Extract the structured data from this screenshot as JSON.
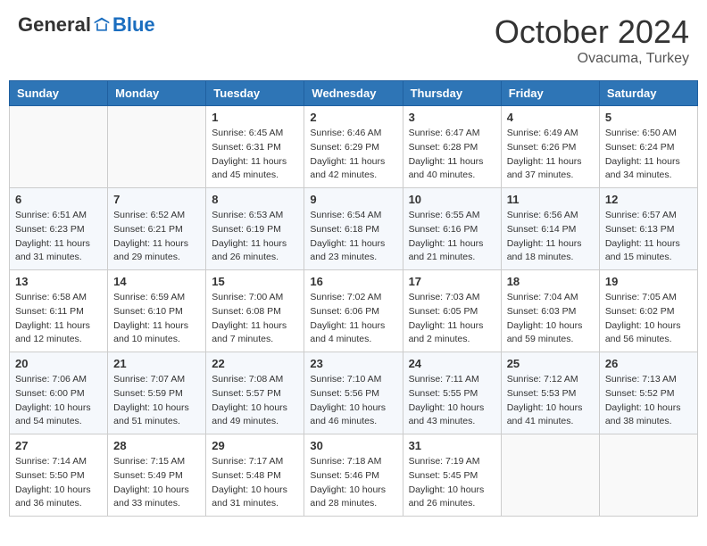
{
  "header": {
    "logo": {
      "general": "General",
      "blue": "Blue",
      "tagline": ""
    },
    "title": "October 2024",
    "subtitle": "Ovacuma, Turkey"
  },
  "weekdays": [
    "Sunday",
    "Monday",
    "Tuesday",
    "Wednesday",
    "Thursday",
    "Friday",
    "Saturday"
  ],
  "weeks": [
    [
      {
        "day": "",
        "sunrise": "",
        "sunset": "",
        "daylight": ""
      },
      {
        "day": "",
        "sunrise": "",
        "sunset": "",
        "daylight": ""
      },
      {
        "day": "1",
        "sunrise": "Sunrise: 6:45 AM",
        "sunset": "Sunset: 6:31 PM",
        "daylight": "Daylight: 11 hours and 45 minutes."
      },
      {
        "day": "2",
        "sunrise": "Sunrise: 6:46 AM",
        "sunset": "Sunset: 6:29 PM",
        "daylight": "Daylight: 11 hours and 42 minutes."
      },
      {
        "day": "3",
        "sunrise": "Sunrise: 6:47 AM",
        "sunset": "Sunset: 6:28 PM",
        "daylight": "Daylight: 11 hours and 40 minutes."
      },
      {
        "day": "4",
        "sunrise": "Sunrise: 6:49 AM",
        "sunset": "Sunset: 6:26 PM",
        "daylight": "Daylight: 11 hours and 37 minutes."
      },
      {
        "day": "5",
        "sunrise": "Sunrise: 6:50 AM",
        "sunset": "Sunset: 6:24 PM",
        "daylight": "Daylight: 11 hours and 34 minutes."
      }
    ],
    [
      {
        "day": "6",
        "sunrise": "Sunrise: 6:51 AM",
        "sunset": "Sunset: 6:23 PM",
        "daylight": "Daylight: 11 hours and 31 minutes."
      },
      {
        "day": "7",
        "sunrise": "Sunrise: 6:52 AM",
        "sunset": "Sunset: 6:21 PM",
        "daylight": "Daylight: 11 hours and 29 minutes."
      },
      {
        "day": "8",
        "sunrise": "Sunrise: 6:53 AM",
        "sunset": "Sunset: 6:19 PM",
        "daylight": "Daylight: 11 hours and 26 minutes."
      },
      {
        "day": "9",
        "sunrise": "Sunrise: 6:54 AM",
        "sunset": "Sunset: 6:18 PM",
        "daylight": "Daylight: 11 hours and 23 minutes."
      },
      {
        "day": "10",
        "sunrise": "Sunrise: 6:55 AM",
        "sunset": "Sunset: 6:16 PM",
        "daylight": "Daylight: 11 hours and 21 minutes."
      },
      {
        "day": "11",
        "sunrise": "Sunrise: 6:56 AM",
        "sunset": "Sunset: 6:14 PM",
        "daylight": "Daylight: 11 hours and 18 minutes."
      },
      {
        "day": "12",
        "sunrise": "Sunrise: 6:57 AM",
        "sunset": "Sunset: 6:13 PM",
        "daylight": "Daylight: 11 hours and 15 minutes."
      }
    ],
    [
      {
        "day": "13",
        "sunrise": "Sunrise: 6:58 AM",
        "sunset": "Sunset: 6:11 PM",
        "daylight": "Daylight: 11 hours and 12 minutes."
      },
      {
        "day": "14",
        "sunrise": "Sunrise: 6:59 AM",
        "sunset": "Sunset: 6:10 PM",
        "daylight": "Daylight: 11 hours and 10 minutes."
      },
      {
        "day": "15",
        "sunrise": "Sunrise: 7:00 AM",
        "sunset": "Sunset: 6:08 PM",
        "daylight": "Daylight: 11 hours and 7 minutes."
      },
      {
        "day": "16",
        "sunrise": "Sunrise: 7:02 AM",
        "sunset": "Sunset: 6:06 PM",
        "daylight": "Daylight: 11 hours and 4 minutes."
      },
      {
        "day": "17",
        "sunrise": "Sunrise: 7:03 AM",
        "sunset": "Sunset: 6:05 PM",
        "daylight": "Daylight: 11 hours and 2 minutes."
      },
      {
        "day": "18",
        "sunrise": "Sunrise: 7:04 AM",
        "sunset": "Sunset: 6:03 PM",
        "daylight": "Daylight: 10 hours and 59 minutes."
      },
      {
        "day": "19",
        "sunrise": "Sunrise: 7:05 AM",
        "sunset": "Sunset: 6:02 PM",
        "daylight": "Daylight: 10 hours and 56 minutes."
      }
    ],
    [
      {
        "day": "20",
        "sunrise": "Sunrise: 7:06 AM",
        "sunset": "Sunset: 6:00 PM",
        "daylight": "Daylight: 10 hours and 54 minutes."
      },
      {
        "day": "21",
        "sunrise": "Sunrise: 7:07 AM",
        "sunset": "Sunset: 5:59 PM",
        "daylight": "Daylight: 10 hours and 51 minutes."
      },
      {
        "day": "22",
        "sunrise": "Sunrise: 7:08 AM",
        "sunset": "Sunset: 5:57 PM",
        "daylight": "Daylight: 10 hours and 49 minutes."
      },
      {
        "day": "23",
        "sunrise": "Sunrise: 7:10 AM",
        "sunset": "Sunset: 5:56 PM",
        "daylight": "Daylight: 10 hours and 46 minutes."
      },
      {
        "day": "24",
        "sunrise": "Sunrise: 7:11 AM",
        "sunset": "Sunset: 5:55 PM",
        "daylight": "Daylight: 10 hours and 43 minutes."
      },
      {
        "day": "25",
        "sunrise": "Sunrise: 7:12 AM",
        "sunset": "Sunset: 5:53 PM",
        "daylight": "Daylight: 10 hours and 41 minutes."
      },
      {
        "day": "26",
        "sunrise": "Sunrise: 7:13 AM",
        "sunset": "Sunset: 5:52 PM",
        "daylight": "Daylight: 10 hours and 38 minutes."
      }
    ],
    [
      {
        "day": "27",
        "sunrise": "Sunrise: 7:14 AM",
        "sunset": "Sunset: 5:50 PM",
        "daylight": "Daylight: 10 hours and 36 minutes."
      },
      {
        "day": "28",
        "sunrise": "Sunrise: 7:15 AM",
        "sunset": "Sunset: 5:49 PM",
        "daylight": "Daylight: 10 hours and 33 minutes."
      },
      {
        "day": "29",
        "sunrise": "Sunrise: 7:17 AM",
        "sunset": "Sunset: 5:48 PM",
        "daylight": "Daylight: 10 hours and 31 minutes."
      },
      {
        "day": "30",
        "sunrise": "Sunrise: 7:18 AM",
        "sunset": "Sunset: 5:46 PM",
        "daylight": "Daylight: 10 hours and 28 minutes."
      },
      {
        "day": "31",
        "sunrise": "Sunrise: 7:19 AM",
        "sunset": "Sunset: 5:45 PM",
        "daylight": "Daylight: 10 hours and 26 minutes."
      },
      {
        "day": "",
        "sunrise": "",
        "sunset": "",
        "daylight": ""
      },
      {
        "day": "",
        "sunrise": "",
        "sunset": "",
        "daylight": ""
      }
    ]
  ]
}
